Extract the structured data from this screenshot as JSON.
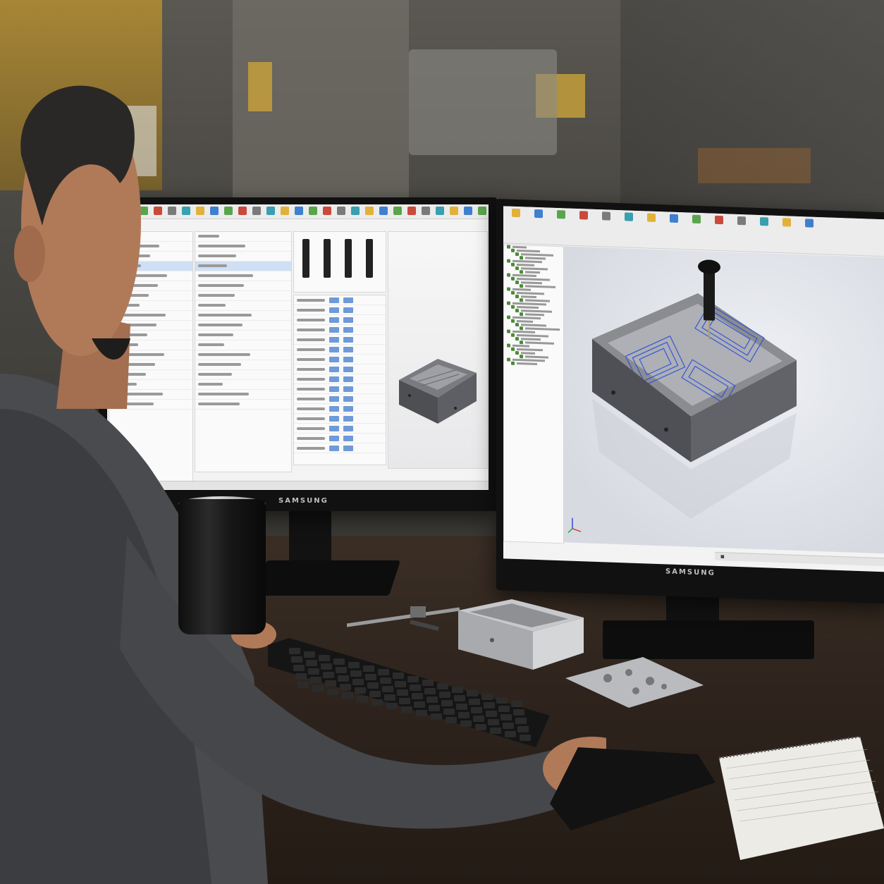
{
  "scene": {
    "description_visible": false
  },
  "monitor_left": {
    "brand": "SAMSUNG",
    "ribbon_count": 28,
    "panel_rows": 18,
    "tool_count": 4
  },
  "monitor_right": {
    "brand": "SAMSUNG",
    "ribbon_count": 14,
    "tree_rows": 34
  },
  "colors": {
    "screen_bg": "#f3f3f3",
    "ribbon_bg": "#ececec",
    "selection": "#cfe0f5",
    "toolpath_blue": "#2b4fd6",
    "part_gray": "#6d6e72",
    "desk": "#2e241d"
  },
  "icons": {
    "ribbon_icon": "toolbar-icon",
    "tree_icon": "feature-icon",
    "axis_icon": "triad-icon"
  }
}
